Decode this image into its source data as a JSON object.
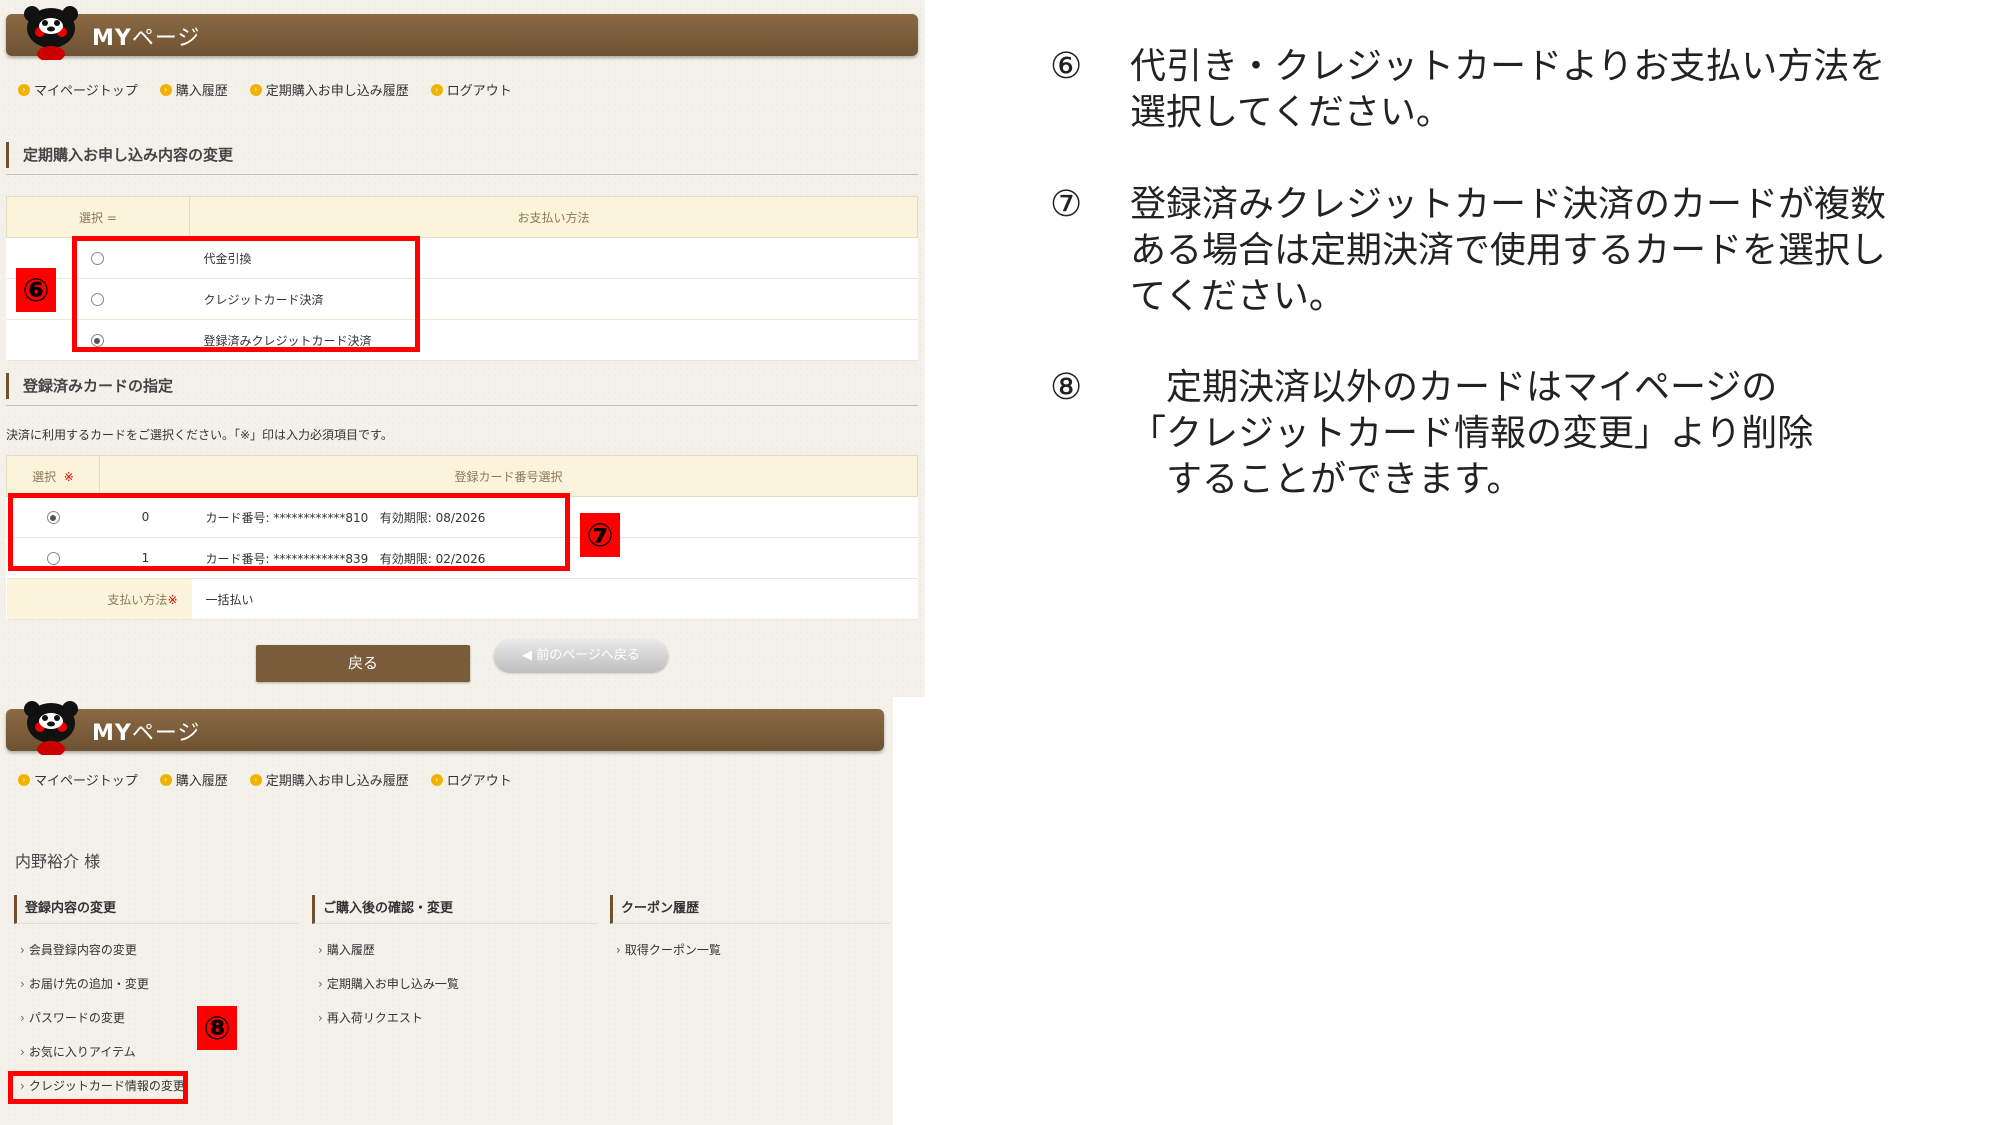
{
  "header": {
    "title_bold": "MY",
    "title_rest": "ページ"
  },
  "nav": [
    "マイページトップ",
    "購入履歴",
    "定期購入お申し込み履歴",
    "ログアウト"
  ],
  "section1": {
    "title": "定期購入お申し込み内容の変更",
    "col_select": "選択",
    "col_select_mark": "=",
    "col_method": "お支払い方法",
    "options": [
      "代金引換",
      "クレジットカード決済",
      "登録済みクレジットカード決済"
    ]
  },
  "section2": {
    "title": "登録済みカードの指定",
    "note": "決済に利用するカードをご選択ください。「※」印は入力必須項目です。",
    "col_select": "選択",
    "required_mark": "※",
    "col_card": "登録カード番号選択",
    "cards": [
      {
        "index": "0",
        "card": "カード番号: ************810",
        "expiry": "有効期限: 08/2026"
      },
      {
        "index": "1",
        "card": "カード番号: ************839",
        "expiry": "有効期限: 02/2026"
      }
    ],
    "pay_label": "支払い方法",
    "pay_value": "一括払い"
  },
  "buttons": {
    "back": "戻る",
    "prev_page": "前のページへ戻る"
  },
  "badges": {
    "b6": "⑥",
    "b7": "⑦",
    "b8": "⑧"
  },
  "mypage": {
    "user_name": "内野裕介 様",
    "columns": [
      {
        "head": "登録内容の変更",
        "links": [
          "会員登録内容の変更",
          "お届け先の追加・変更",
          "パスワードの変更",
          "お気に入りアイテム",
          "クレジットカード情報の変更"
        ]
      },
      {
        "head": "ご購入後の確認・変更",
        "links": [
          "購入履歴",
          "定期購入お申し込み一覧",
          "再入荷リクエスト"
        ]
      },
      {
        "head": "クーポン履歴",
        "links": [
          "取得クーポン一覧"
        ]
      }
    ]
  },
  "instructions": [
    {
      "num": "⑥",
      "text": "代引き・クレジットカードよりお支払い方法を\n選択してください。"
    },
    {
      "num": "⑦",
      "text": "登録済みクレジットカード決済のカードが複数\nある場合は定期決済で使用するカードを選択し\nてください。"
    },
    {
      "num": "⑧",
      "text": "　定期決済以外のカードはマイページの\n「クレジットカード情報の変更」より削除\n　することができます。"
    }
  ],
  "colors": {
    "brown": "#6e5232",
    "red_highlight": "#ff0000",
    "nav_dot": "#f0b400"
  }
}
